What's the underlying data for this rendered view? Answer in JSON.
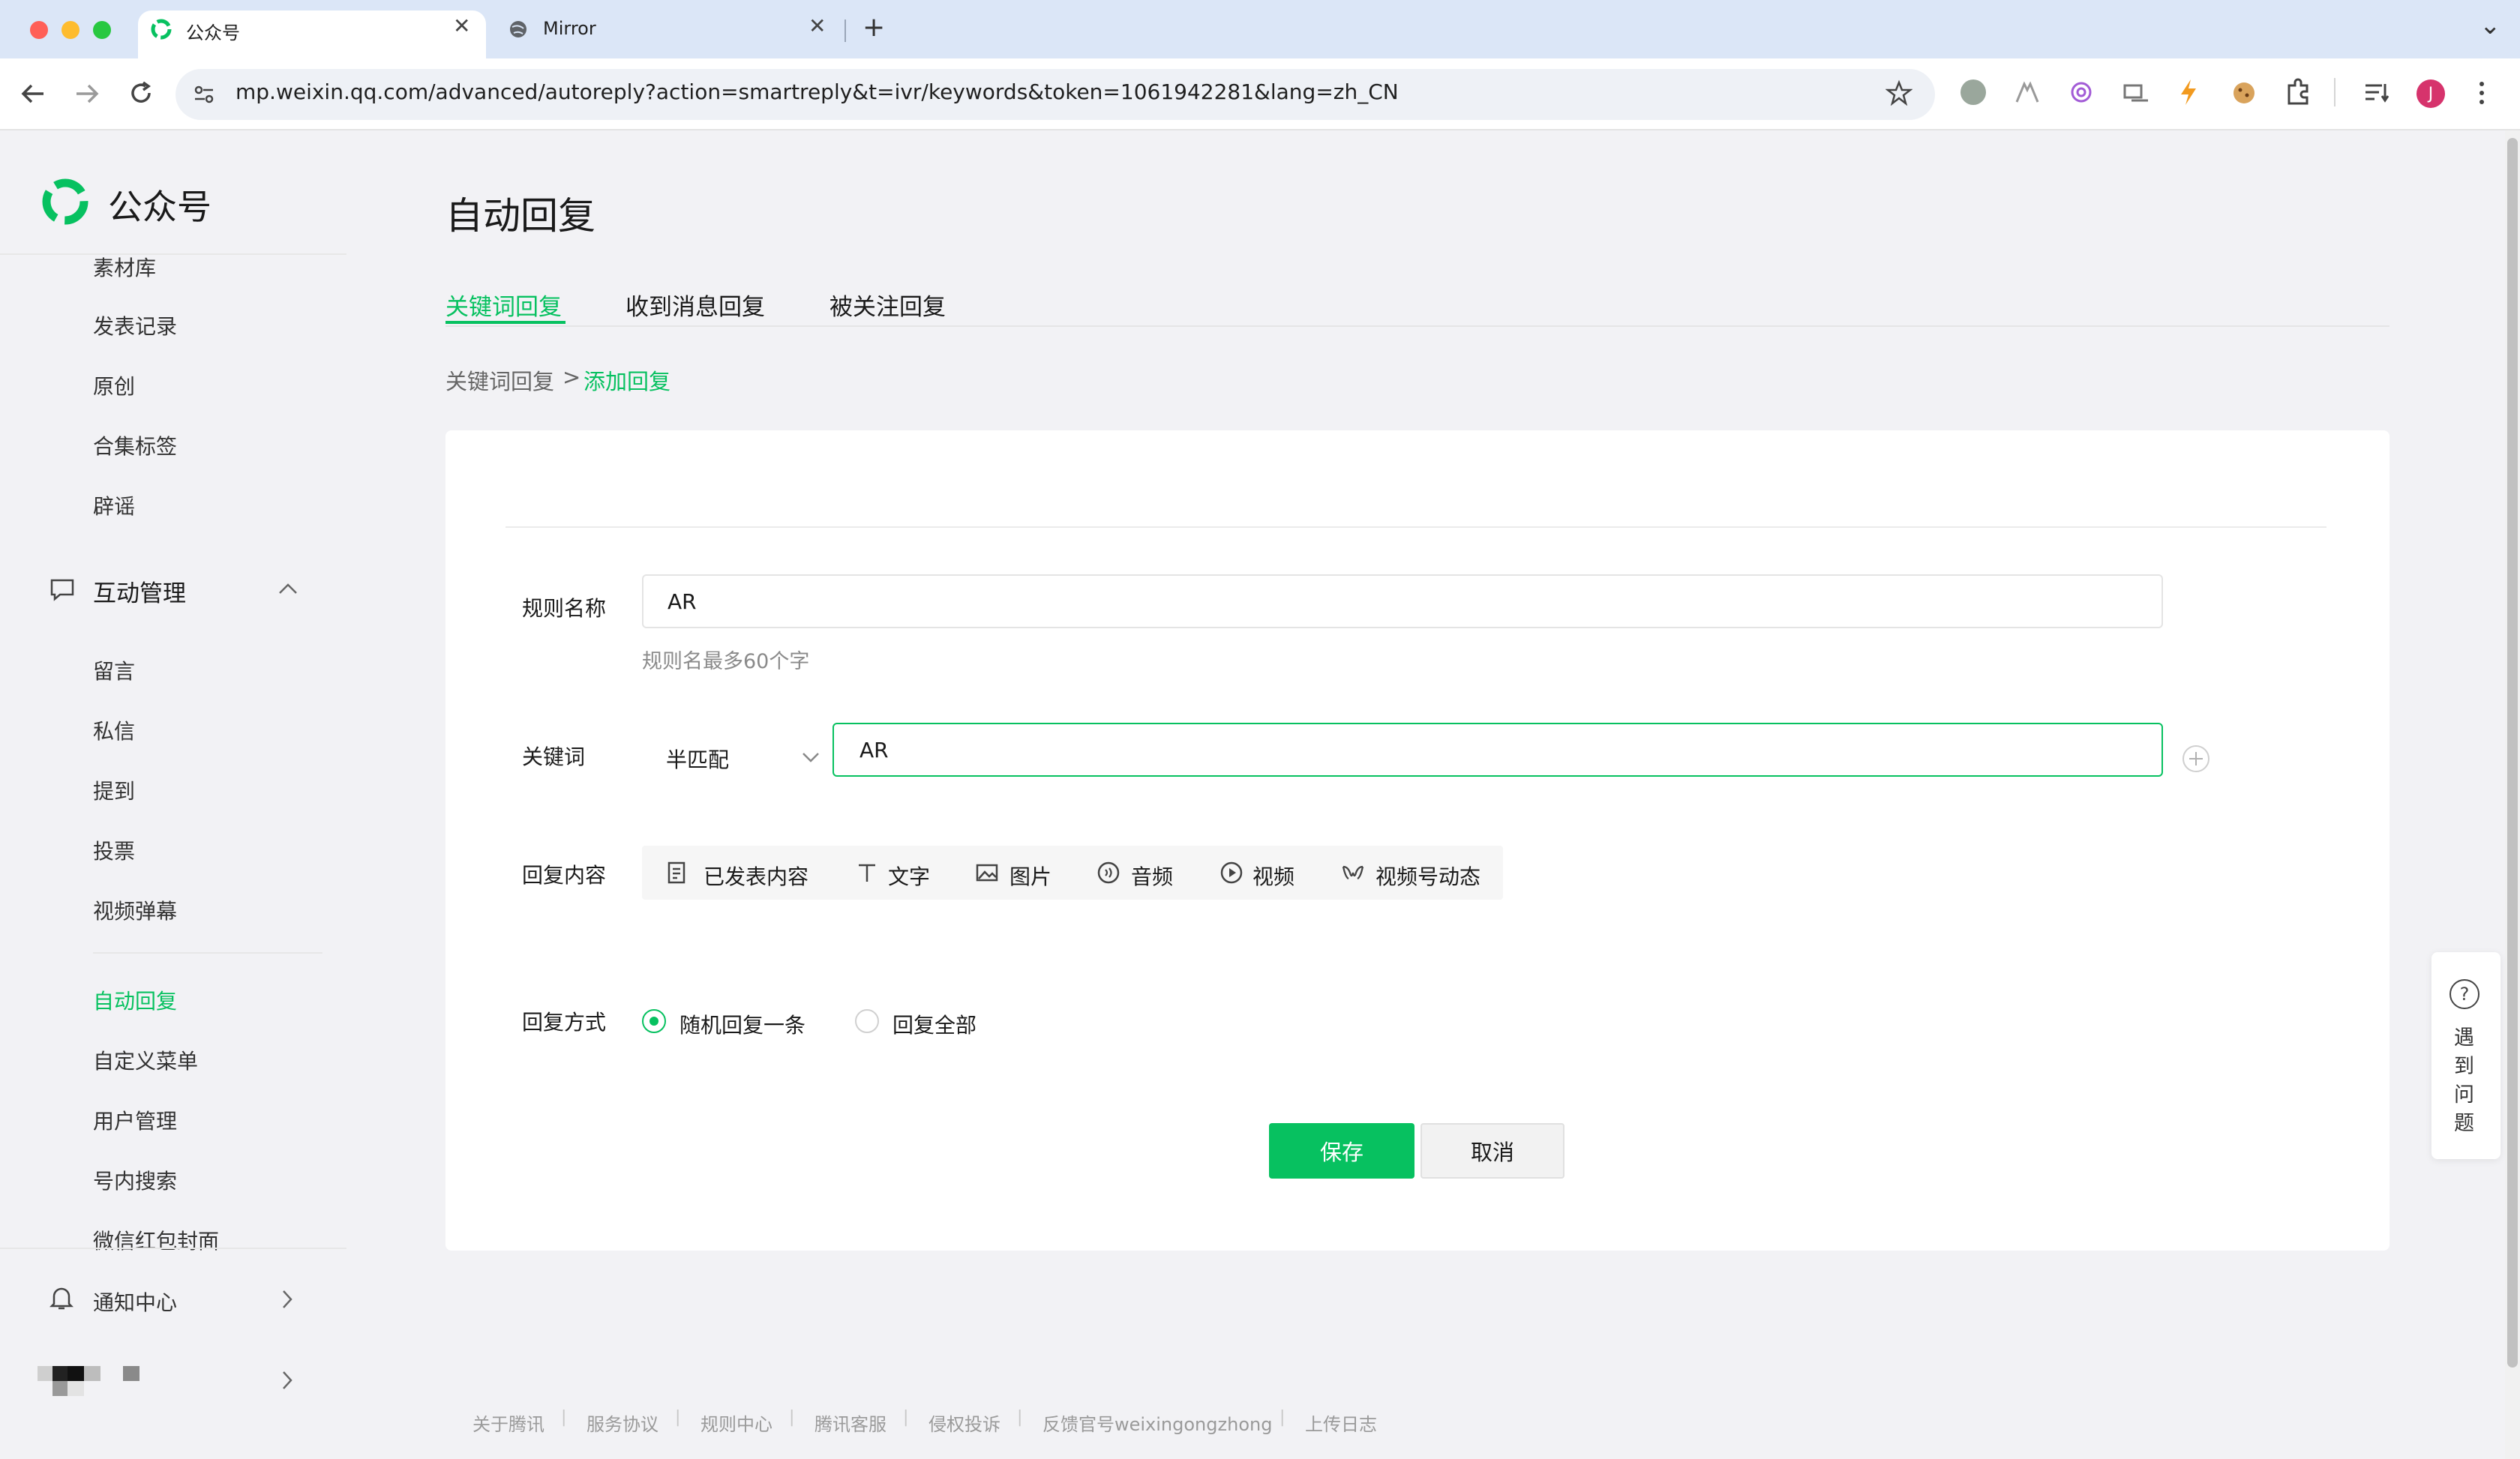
{
  "browser": {
    "tabs": [
      {
        "title": "公众号",
        "close": "✕"
      },
      {
        "title": "Mirror",
        "close": "✕"
      }
    ],
    "new_tab": "+",
    "tab_menu": "⌄",
    "url": "mp.weixin.qq.com/advanced/autoreply?action=smartreply&t=ivr/keywords&token=1061942281&lang=zh_CN",
    "profile_initial": "J"
  },
  "app": {
    "logo_text": "公众号"
  },
  "sidebar": {
    "content_items": [
      "素材库",
      "发表记录",
      "原创",
      "合集标签",
      "辟谣"
    ],
    "interaction_group": "互动管理",
    "interaction_items": [
      "留言",
      "私信",
      "提到",
      "投票",
      "视频弹幕"
    ],
    "other_items": [
      "自动回复",
      "自定义菜单",
      "用户管理",
      "号内搜索",
      "微信红包封面"
    ],
    "notification": "通知中心"
  },
  "main": {
    "title": "自动回复",
    "tabs": [
      "关键词回复",
      "收到消息回复",
      "被关注回复"
    ],
    "breadcrumb": {
      "parent": "关键词回复",
      "sep": ">",
      "current": "添加回复"
    },
    "form": {
      "rule_name_label": "规则名称",
      "rule_name_value": "AR",
      "rule_name_hint": "规则名最多60个字",
      "keyword_label": "关键词",
      "match_mode": "半匹配",
      "keyword_value": "AR",
      "reply_content_label": "回复内容",
      "reply_types": [
        "已发表内容",
        "文字",
        "图片",
        "音频",
        "视频",
        "视频号动态"
      ],
      "reply_mode_label": "回复方式",
      "reply_modes": [
        "随机回复一条",
        "回复全部"
      ],
      "save": "保存",
      "cancel": "取消"
    }
  },
  "help": {
    "chars": [
      "遇",
      "到",
      "问",
      "题"
    ],
    "icon": "?"
  },
  "footer": {
    "links": [
      "关于腾讯",
      "服务协议",
      "规则中心",
      "腾讯客服",
      "侵权投诉",
      "反馈官号weixingongzhong",
      "上传日志"
    ]
  },
  "colors": {
    "accent": "#07c160",
    "chrome": "#dbe6f7"
  }
}
